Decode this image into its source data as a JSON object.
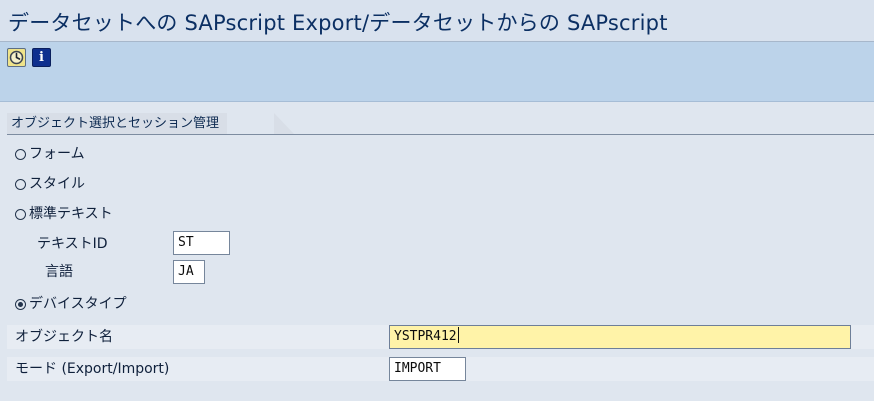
{
  "window": {
    "title": "データセットへの SAPscript Export/データセットからの SAPscript"
  },
  "toolbar": {
    "buttons": [
      {
        "name": "execute",
        "icon": "clock-execute-icon"
      },
      {
        "name": "info",
        "icon": "info-icon",
        "glyph": "i"
      }
    ]
  },
  "section": {
    "title": "オブジェクト選択とセッション管理"
  },
  "options": {
    "form": {
      "label": "フォーム",
      "selected": false
    },
    "style": {
      "label": "スタイル",
      "selected": false
    },
    "standard_text": {
      "label": "標準テキスト",
      "selected": false
    },
    "device_type": {
      "label": "デバイスタイプ",
      "selected": true
    }
  },
  "fields": {
    "text_id": {
      "label": "テキストID",
      "value": "ST"
    },
    "language": {
      "label": "言語",
      "value": "JA"
    },
    "object_name": {
      "label": "オブジェクト名",
      "value": "YSTPR412"
    },
    "mode": {
      "label": "モード (Export/Import)",
      "value": "IMPORT"
    }
  },
  "colors": {
    "title_bar": "#d9e2ee",
    "toolbar": "#bcd3ea",
    "active_field": "#fff3a8",
    "text": "#0f203b"
  }
}
